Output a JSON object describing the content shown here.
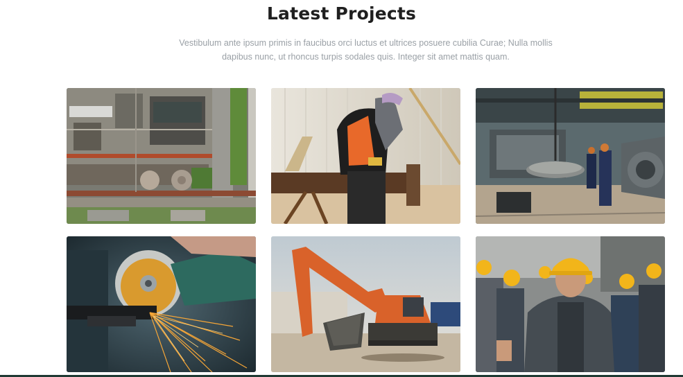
{
  "section": {
    "title": "Latest Projects",
    "subtitle": "Vestibulum ante ipsum primis in faucibus orci luctus et ultrices posuere cubilia Curae; Nulla mollis dapibus nunc, ut rhoncus turpis sodales quis. Integer sit amet mattis quam."
  },
  "projects": [
    {
      "image": "industrial-plant-aerial-photo"
    },
    {
      "image": "welder-at-work-photo"
    },
    {
      "image": "heavy-machinery-factory-photo"
    },
    {
      "image": "angle-grinder-sparks-photo"
    },
    {
      "image": "orange-excavator-photo"
    },
    {
      "image": "workers-hard-hats-photo"
    }
  ],
  "colors": {
    "title": "#1f1f1f",
    "subtitle": "#9aa0a6",
    "background": "#ffffff"
  }
}
